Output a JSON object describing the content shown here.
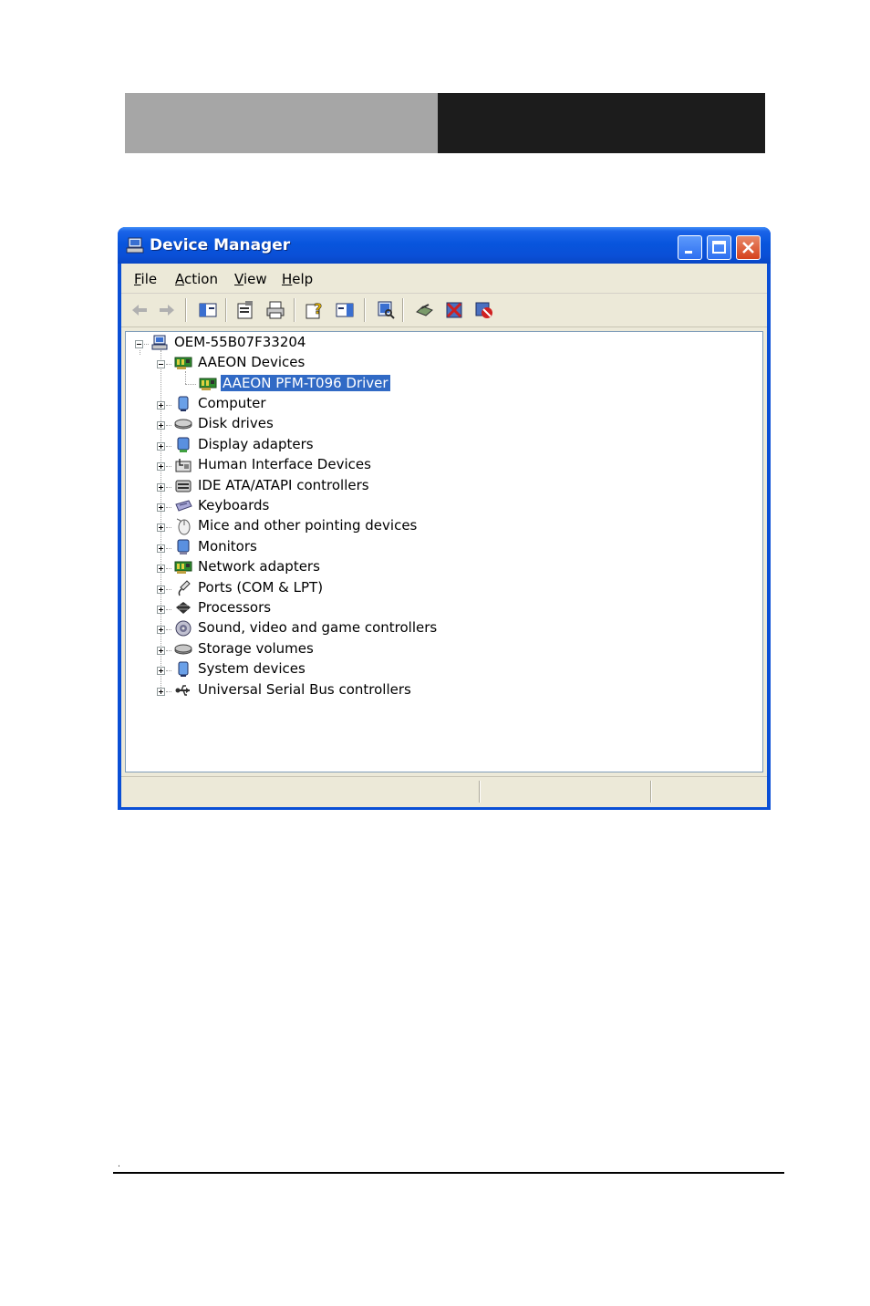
{
  "window": {
    "title": "Device Manager"
  },
  "menu": [
    {
      "label": "File",
      "accel": "F",
      "rest": "ile"
    },
    {
      "label": "Action",
      "accel": "A",
      "rest": "ction"
    },
    {
      "label": "View",
      "accel": "V",
      "rest": "iew"
    },
    {
      "label": "Help",
      "accel": "H",
      "rest": "elp"
    }
  ],
  "toolbar": {
    "icons": [
      "back-arrow-icon",
      "forward-arrow-icon",
      "show-hide-tree-icon",
      "properties-icon",
      "print-icon",
      "help-icon",
      "show-hide-action-pane-icon",
      "scan-hardware-icon",
      "update-driver-icon",
      "uninstall-icon",
      "disable-icon"
    ]
  },
  "tree": {
    "root": "OEM-55B07F33204",
    "categories": [
      {
        "label": "AAEON Devices",
        "icon": "network-card-icon",
        "expanded": true,
        "children": [
          {
            "label": "AAEON PFM-T096 Driver",
            "icon": "network-card-icon",
            "selected": true
          }
        ]
      },
      {
        "label": "Computer",
        "icon": "computer-icon"
      },
      {
        "label": "Disk drives",
        "icon": "disk-drive-icon"
      },
      {
        "label": "Display adapters",
        "icon": "display-adapter-icon"
      },
      {
        "label": "Human Interface Devices",
        "icon": "hid-icon"
      },
      {
        "label": "IDE ATA/ATAPI controllers",
        "icon": "ide-controller-icon"
      },
      {
        "label": "Keyboards",
        "icon": "keyboard-icon"
      },
      {
        "label": "Mice and other pointing devices",
        "icon": "mouse-icon"
      },
      {
        "label": "Monitors",
        "icon": "monitor-icon"
      },
      {
        "label": "Network adapters",
        "icon": "network-card-icon"
      },
      {
        "label": "Ports (COM & LPT)",
        "icon": "port-icon"
      },
      {
        "label": "Processors",
        "icon": "processor-icon"
      },
      {
        "label": "Sound, video and game controllers",
        "icon": "sound-icon"
      },
      {
        "label": "Storage volumes",
        "icon": "storage-volume-icon"
      },
      {
        "label": "System devices",
        "icon": "system-device-icon"
      },
      {
        "label": "Universal Serial Bus controllers",
        "icon": "usb-icon"
      }
    ]
  },
  "footer": {
    "mark": "."
  },
  "colors": {
    "titlebar": "#0a4fd6",
    "selection": "#316ac5",
    "header_left": "#a6a6a6",
    "header_right": "#1c1c1c"
  }
}
